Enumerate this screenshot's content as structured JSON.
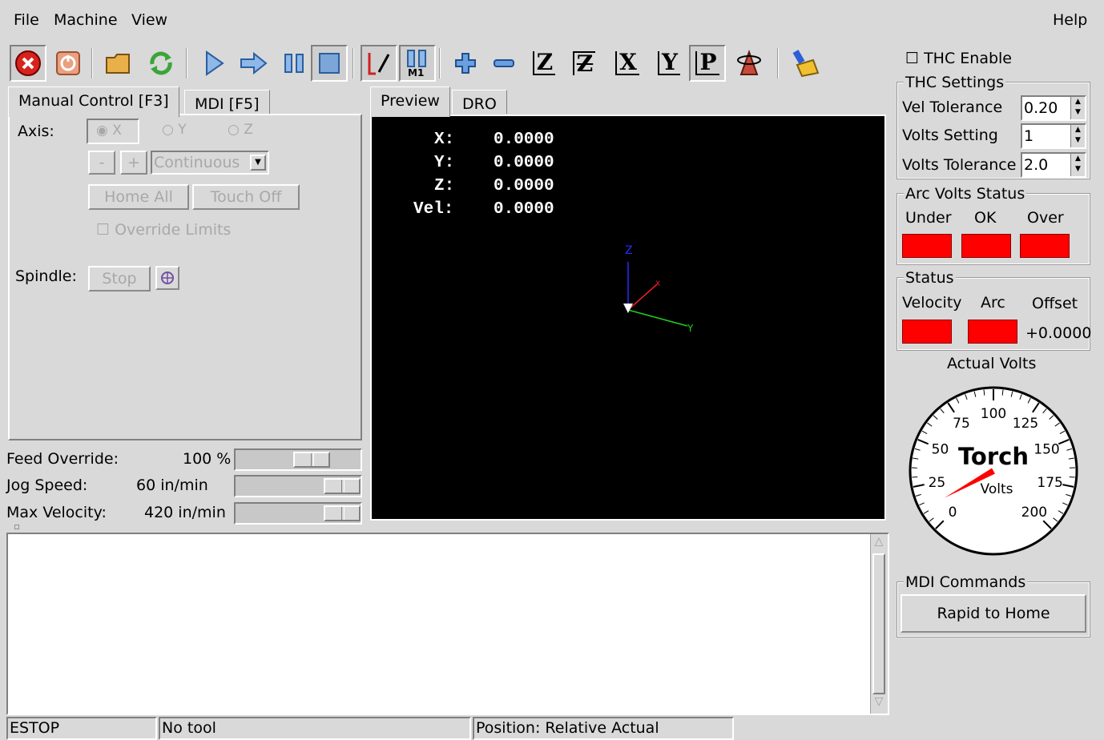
{
  "menubar": {
    "file": "File",
    "machine": "Machine",
    "view": "View",
    "help": "Help"
  },
  "toolbar": {
    "buttons": [
      "estop-icon",
      "machine-power-icon",
      "open-file-icon",
      "reload-icon",
      "run-icon",
      "step-icon",
      "pause-icon",
      "stop-icon",
      "block-delete-icon",
      "optional-stop-icon",
      "zoom-in-icon",
      "zoom-out-icon",
      "view-z-icon",
      "view-z-rotated-icon",
      "view-x-icon",
      "view-y-icon",
      "view-p-icon",
      "rotate-view-icon",
      "clear-plot-icon"
    ],
    "optional_stop_label": "M1",
    "axis_z": "Z",
    "axis_z2": "Z",
    "axis_x": "X",
    "axis_y": "Y",
    "axis_p": "P"
  },
  "left_tabs": {
    "manual": "Manual Control [F3]",
    "mdi": "MDI [F5]"
  },
  "manual": {
    "axis_label": "Axis:",
    "axis_x": "X",
    "axis_y": "Y",
    "axis_z": "Z",
    "minus": "-",
    "plus": "+",
    "jog_mode": "Continuous",
    "home_all": "Home All",
    "touch_off": "Touch Off",
    "override_limits": "Override Limits",
    "spindle_label": "Spindle:",
    "spindle_stop": "Stop"
  },
  "overrides": {
    "feed_label": "Feed Override:",
    "feed_value": "100 %",
    "jog_label": "Jog Speed:",
    "jog_value": "60 in/min",
    "maxvel_label": "Max Velocity:",
    "maxvel_value": "420 in/min"
  },
  "view_tabs": {
    "preview": "Preview",
    "dro": "DRO"
  },
  "dro": {
    "x_label": "X:",
    "x_value": "0.0000",
    "y_label": "Y:",
    "y_value": "0.0000",
    "z_label": "Z:",
    "z_value": "0.0000",
    "vel_label": "Vel:",
    "vel_value": "0.0000"
  },
  "preview_axes": {
    "z": "Z",
    "x": "X",
    "y": "Y",
    "colors": {
      "x": "#ff0000",
      "y": "#00ff00",
      "z": "#0000ff"
    }
  },
  "thc": {
    "enable_label": "THC Enable",
    "settings_title": "THC Settings",
    "vel_tol_label": "Vel Tolerance",
    "vel_tol_value": "0.20",
    "volts_setting_label": "Volts Setting",
    "volts_setting_value": "1",
    "volts_tol_label": "Volts Tolerance",
    "volts_tol_value": "2.0",
    "arc_status_title": "Arc Volts Status",
    "under": "Under",
    "ok": "OK",
    "over": "Over",
    "status_title": "Status",
    "velocity": "Velocity",
    "arc": "Arc",
    "offset": "Offset",
    "offset_value": "+0.0000",
    "actual_volts": "Actual Volts",
    "gauge_title": "Torch",
    "gauge_subtitle": "Volts",
    "gauge_ticks": [
      "0",
      "25",
      "50",
      "75",
      "100",
      "125",
      "150",
      "175",
      "200"
    ],
    "gauge_value": 12,
    "mdi_title": "MDI Commands",
    "rapid_home": "Rapid to Home",
    "led_color": "#ff0000"
  },
  "statusbar": {
    "estop": "ESTOP",
    "tool": "No tool",
    "position": "Position: Relative Actual"
  }
}
